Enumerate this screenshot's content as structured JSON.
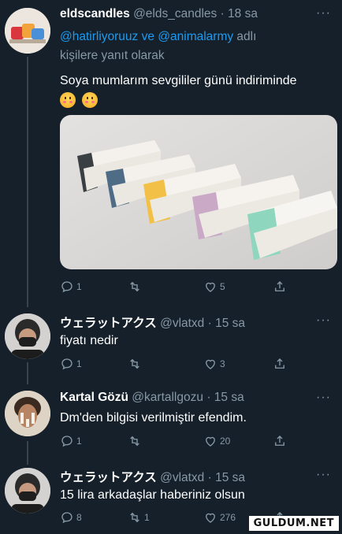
{
  "tweets": [
    {
      "name": "eldscandles",
      "handle": "@elds_candles",
      "time": "· 18 sa",
      "more": "···",
      "reply_prefix": "",
      "reply_handles": "@hatirliyoruuz ve @animalarmy",
      "reply_suffix": " adlı",
      "reply_line2": "kişilere yanıt olarak",
      "text": "Soya mumlarım sevgililer günü indiriminde",
      "emojis": [
        "hot-face",
        "hot-face"
      ],
      "reply_count": "1",
      "retweet_count": "",
      "like_count": "5"
    },
    {
      "name": "ウェラットアクス",
      "handle": "@vlatxd",
      "time": "· 15 sa",
      "more": "···",
      "text": "fiyatı nedir",
      "reply_count": "1",
      "retweet_count": "",
      "like_count": "3"
    },
    {
      "name": "Kartal Gözü",
      "handle": "@kartallgozu",
      "time": "· 15 sa",
      "more": "···",
      "text": "Dm'den bilgisi verilmiştir efendim.",
      "reply_count": "1",
      "retweet_count": "",
      "like_count": "20"
    },
    {
      "name": "ウェラットアクス",
      "handle": "@vlatxd",
      "time": "· 15 sa",
      "more": "···",
      "text": "15 lira arkadaşlar haberiniz olsun",
      "reply_count": "8",
      "retweet_count": "1",
      "like_count": "276"
    }
  ],
  "watermark": "GULDUM.NET",
  "colors": {
    "background": "#15202b",
    "muted": "#8899a6",
    "link": "#1d9bf0"
  }
}
